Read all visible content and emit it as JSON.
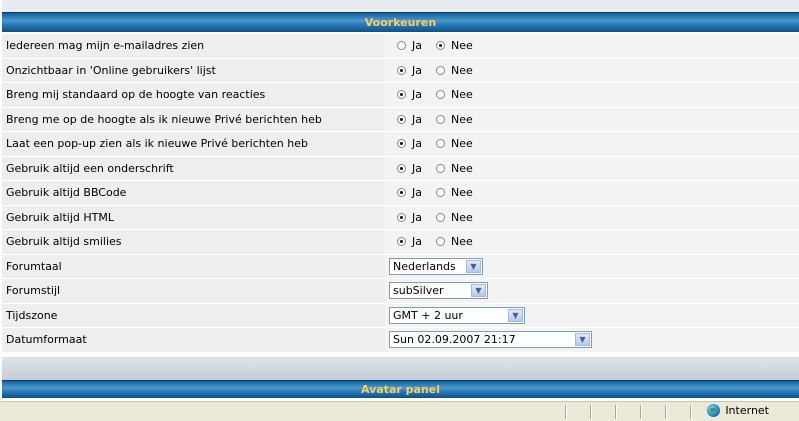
{
  "preferences": {
    "title": "Voorkeuren",
    "yes_label": "Ja",
    "no_label": "Nee",
    "radio_rows": [
      {
        "label": "Iedereen mag mijn e-mailadres zien",
        "selected": "no"
      },
      {
        "label": "Onzichtbaar in 'Online gebruikers' lijst",
        "selected": "yes"
      },
      {
        "label": "Breng mij standaard op de hoogte van reacties",
        "selected": "yes"
      },
      {
        "label": "Breng me op de hoogte als ik nieuwe Privé berichten heb",
        "selected": "yes"
      },
      {
        "label": "Laat een pop-up zien als ik nieuwe Privé berichten heb",
        "selected": "yes"
      },
      {
        "label": "Gebruik altijd een onderschrift",
        "selected": "yes"
      },
      {
        "label": "Gebruik altijd BBCode",
        "selected": "yes"
      },
      {
        "label": "Gebruik altijd HTML",
        "selected": "yes"
      },
      {
        "label": "Gebruik altijd smilies",
        "selected": "yes"
      }
    ],
    "select_rows": [
      {
        "label": "Forumtaal",
        "value": "Nederlands"
      },
      {
        "label": "Forumstijl",
        "value": "subSilver"
      },
      {
        "label": "Tijdszone",
        "value": "GMT + 2 uur"
      },
      {
        "label": "Datumformaat",
        "value": "Sun 02.09.2007 21:17"
      }
    ]
  },
  "avatar_panel": {
    "title": "Avatar panel"
  },
  "statusbar": {
    "zone": "Internet"
  },
  "colors": {
    "header_text": "#fbcf5e",
    "header_bg": "#2a7cb9"
  },
  "icons": {
    "dropdown": "chevron-down-icon",
    "zone": "globe-icon"
  }
}
